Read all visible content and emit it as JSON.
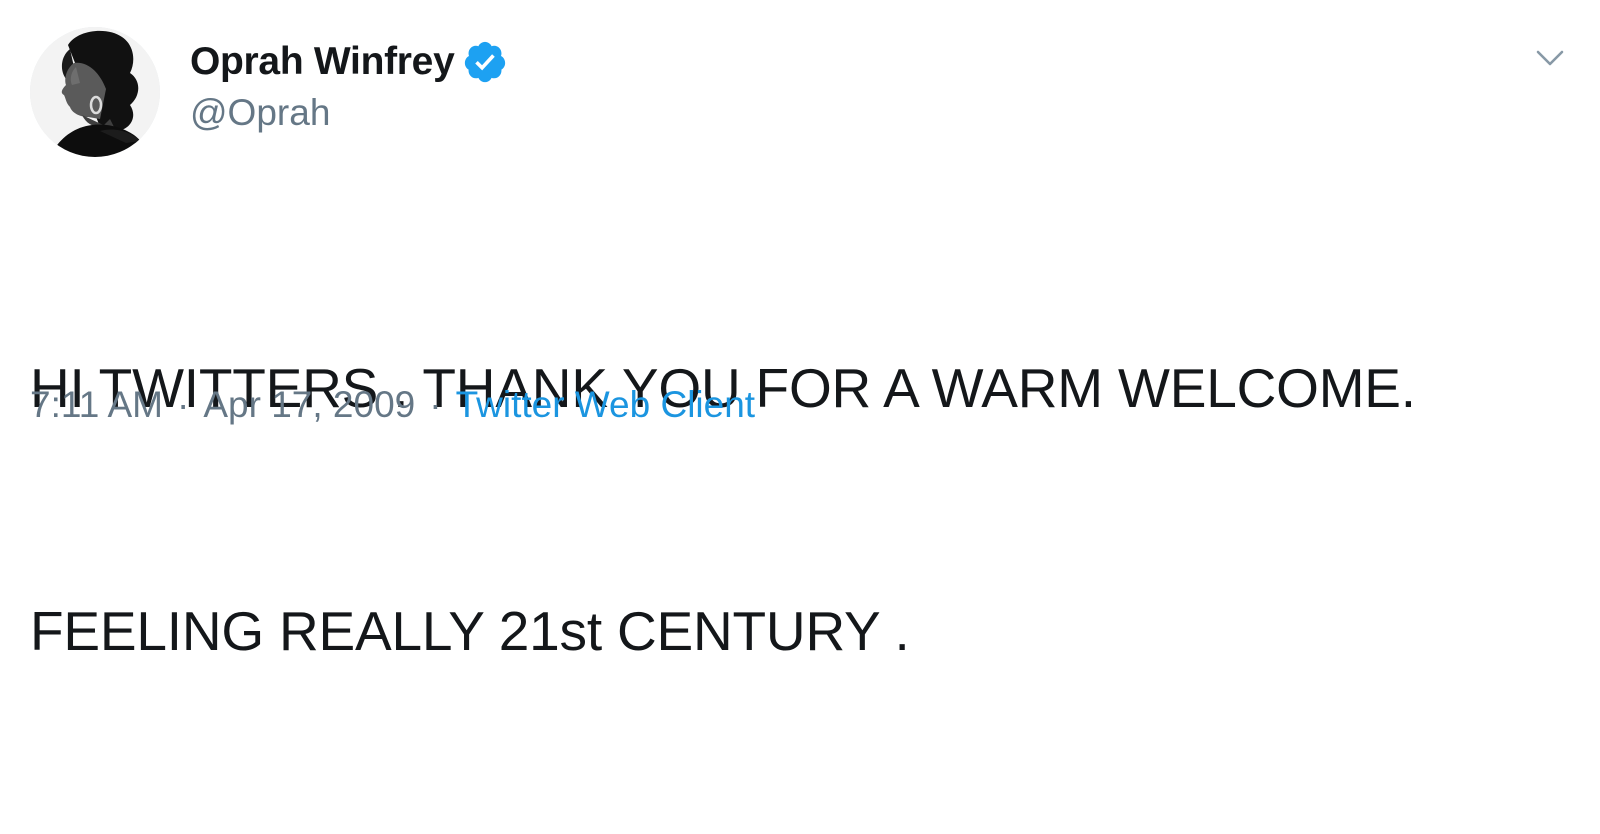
{
  "author": {
    "display_name": "Oprah Winfrey",
    "handle": "@Oprah",
    "verified": true,
    "verified_color": "#1da1f2"
  },
  "tweet": {
    "text_lines": [
      "HI TWITTERS . THANK YOU FOR A WARM WELCOME.",
      "FEELING REALLY 21st CENTURY ."
    ],
    "time": "7:11 AM",
    "separator": "·",
    "date": "Apr 17, 2009",
    "source": "Twitter Web Client"
  },
  "icons": {
    "verified": "verified-badge-icon",
    "menu": "chevron-down-icon"
  },
  "colors": {
    "text_primary": "#14171a",
    "text_secondary": "#657786",
    "link": "#1b95e0"
  }
}
